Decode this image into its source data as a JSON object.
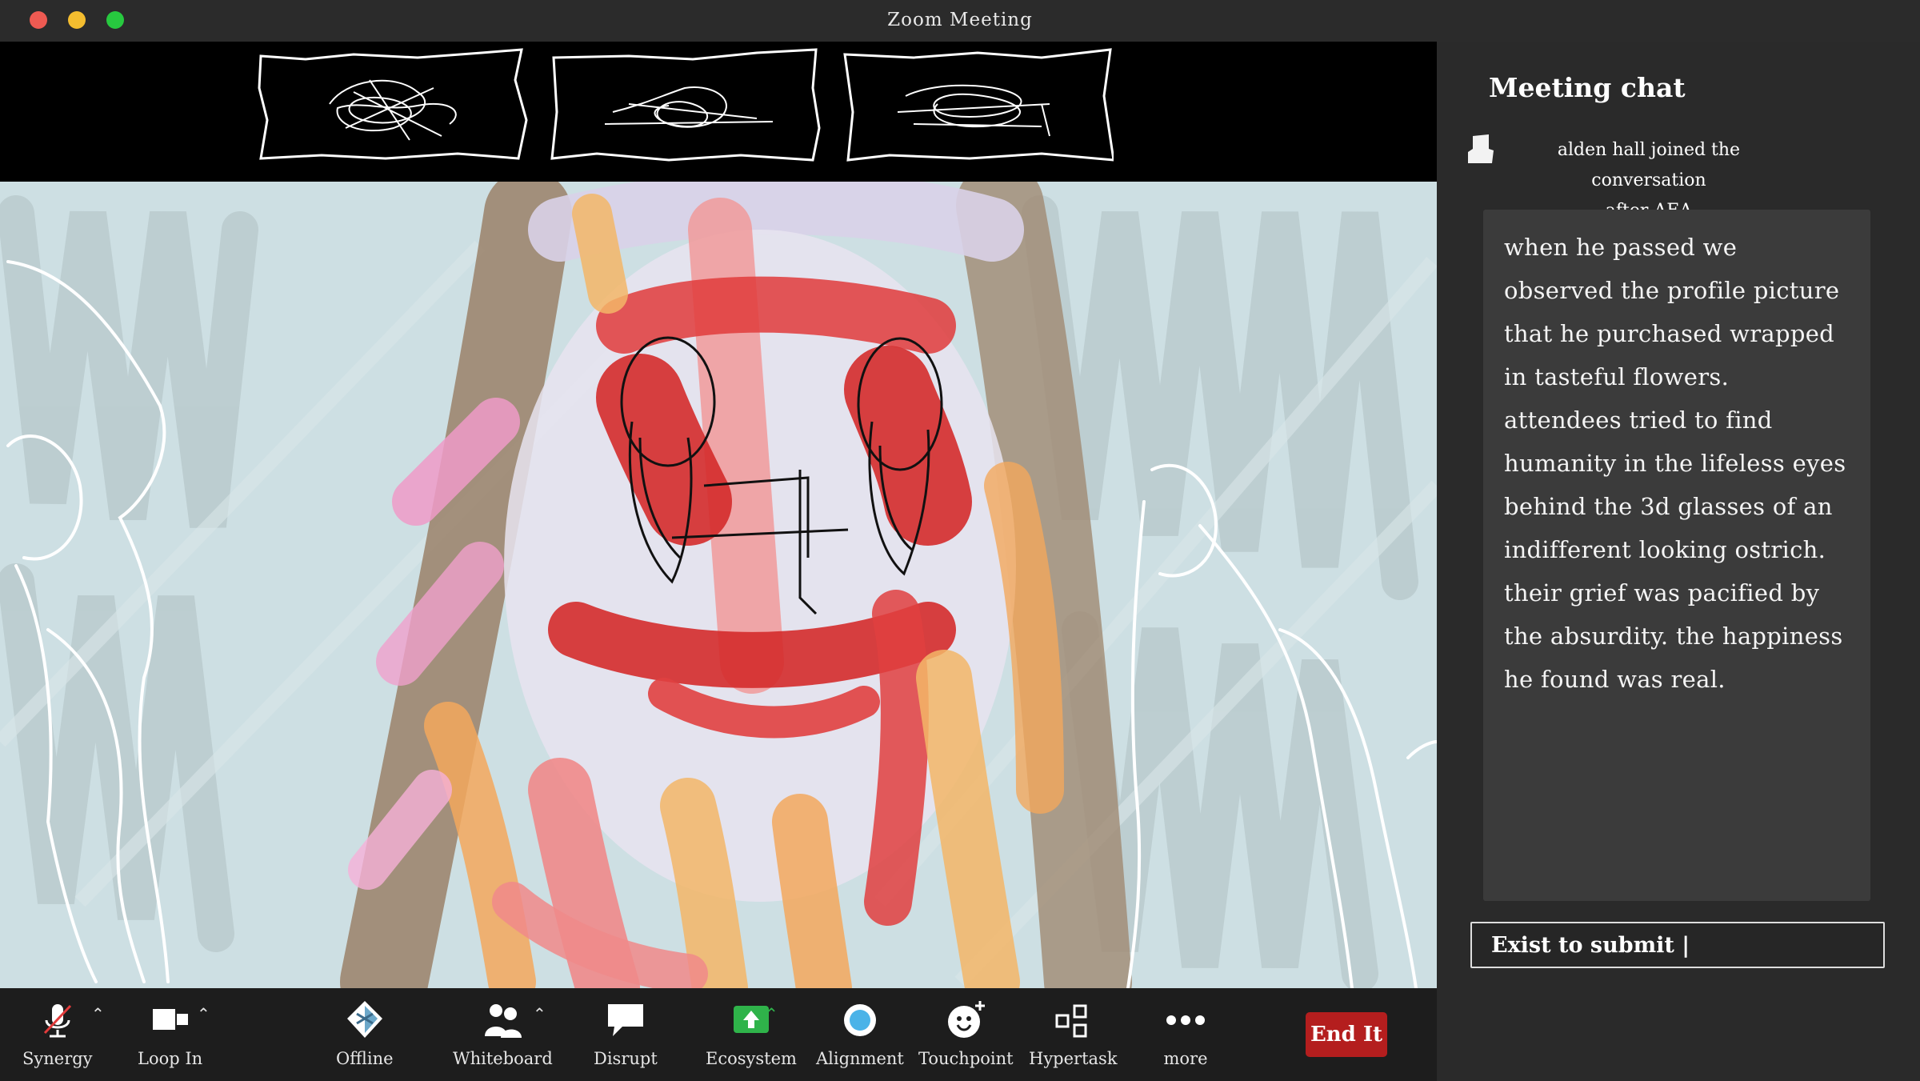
{
  "window": {
    "title": "Zoom Meeting"
  },
  "thumbnails": [
    {
      "name": "participant-1"
    },
    {
      "name": "participant-2"
    },
    {
      "name": "participant-3"
    }
  ],
  "chat": {
    "title": "Meeting chat",
    "event_line1": "alden hall  joined the conversation",
    "event_line2": "after AEA",
    "message": "when he passed we observed the profile picture that he purchased wrapped in tasteful flowers. attendees tried to find humanity in the lifeless eyes behind the 3d glasses of an indifferent looking ostrich. their grief was pacified by the absurdity. the happiness he found was real.",
    "input_value": "Exist to submit |"
  },
  "toolbar": {
    "synergy": "Synergy",
    "loop_in": "Loop In",
    "offline": "Offline",
    "whiteboard": "Whiteboard",
    "disrupt": "Disrupt",
    "ecosystem": "Ecosystem",
    "alignment": "Alignment",
    "touchpoint": "Touchpoint",
    "hypertask": "Hypertask",
    "more": "more",
    "end": "End It"
  },
  "colors": {
    "end_button": "#b41e1e",
    "ecosystem_icon": "#2fb34a",
    "alignment_icon": "#4ab3e8",
    "mute_slash": "#e23b3b"
  }
}
